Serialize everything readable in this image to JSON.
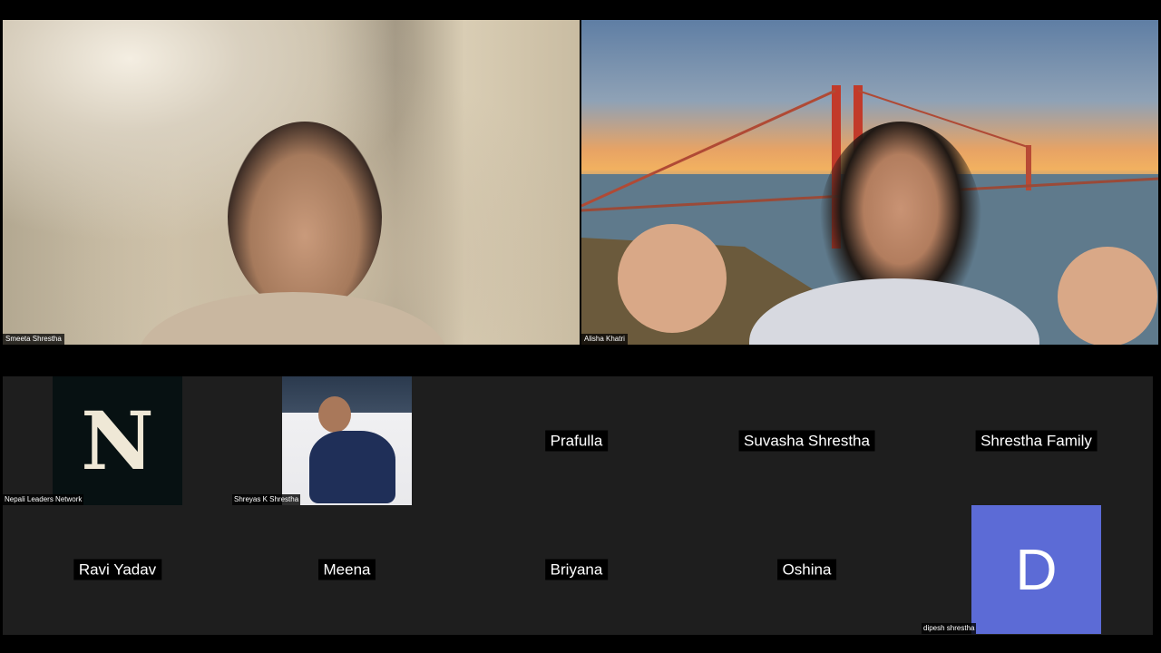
{
  "speakers": [
    {
      "name": "Smeeta Shrestha"
    },
    {
      "name": "Alisha Khatri"
    }
  ],
  "gallery": {
    "row1": [
      {
        "name": "Nepali Leaders Network",
        "avatar": "N"
      },
      {
        "name": "Shreyas K Shrestha"
      },
      {
        "name": "Prafulla"
      },
      {
        "name": "Suvasha Shrestha"
      },
      {
        "name": "Shrestha Family"
      }
    ],
    "row2": [
      {
        "name": "Ravi Yadav"
      },
      {
        "name": "Meena"
      },
      {
        "name": "Briyana"
      },
      {
        "name": "Oshina"
      },
      {
        "name": "dipesh shrestha",
        "avatar": "D"
      }
    ]
  },
  "colors": {
    "avatar_d": "#5c6bd6",
    "avatar_n": "#071112"
  }
}
